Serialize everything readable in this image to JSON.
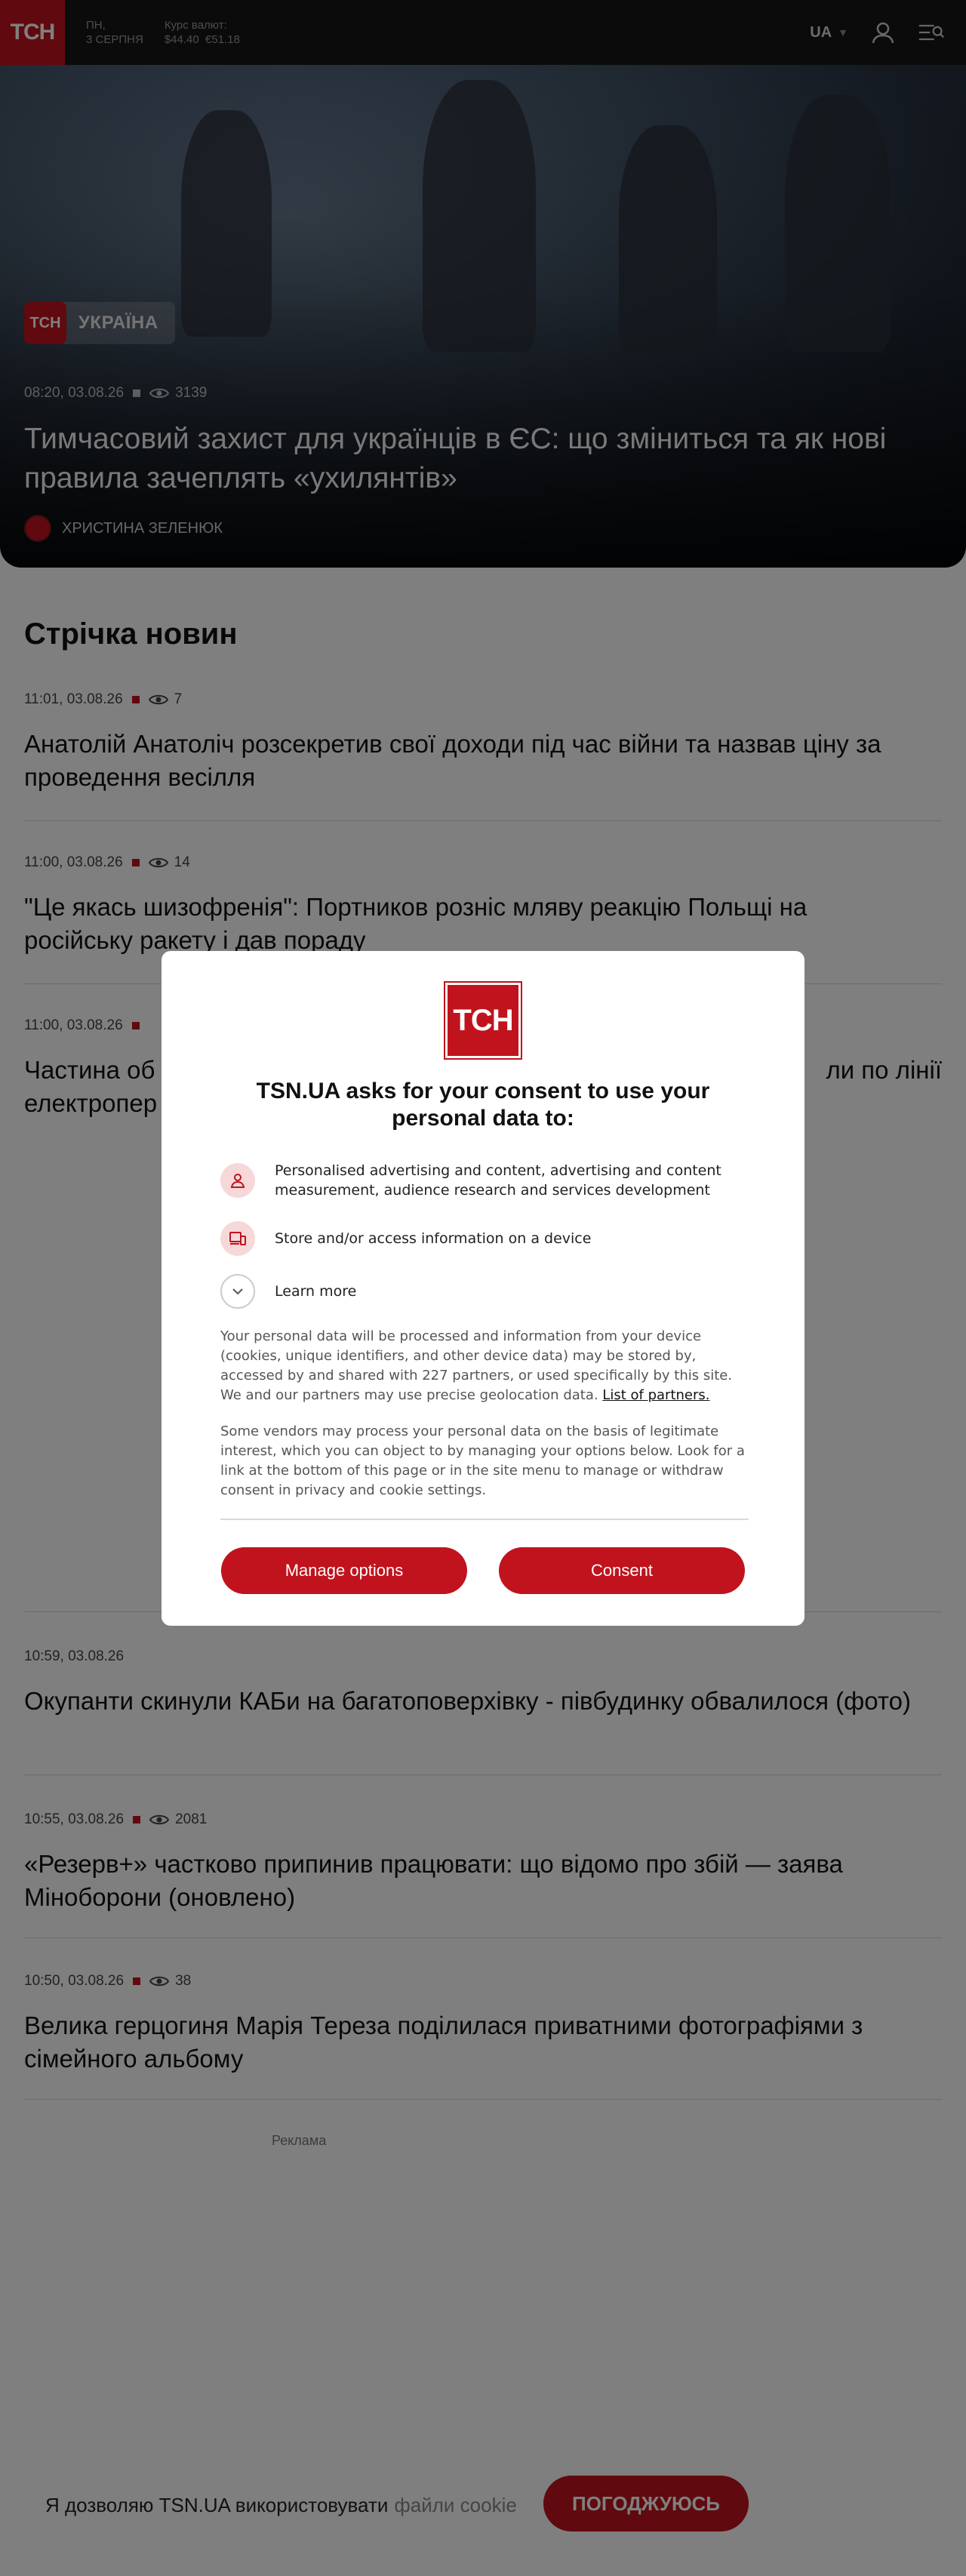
{
  "header": {
    "logo": "ТСН",
    "date_line1": "ПН,",
    "date_line2": "3 СЕРПНЯ",
    "rates_label": "Курс валют:",
    "rate_usd": "$44.40",
    "rate_eur": "€51.18",
    "language": "UA"
  },
  "hero": {
    "category": "УКРАЇНА",
    "tag_logo": "ТСН",
    "time": "08:20, 03.08.26",
    "views": "3139",
    "title": "Тимчасовий захист для українців в ЄС: що зміниться та як нові правила зачеплять «ухилянтів»",
    "author": "ХРИСТИНА ЗЕЛЕНЮК"
  },
  "feed": {
    "title": "Стрічка новин",
    "items": [
      {
        "time": "11:01, 03.08.26",
        "views": "7",
        "title": "Анатолій Анатоліч розсекретив свої доходи під час війни та назвав ціну за проведення весілля"
      },
      {
        "time": "11:00, 03.08.26",
        "views": "14",
        "title": "\"Це якась шизофренія\": Портников розніс мляву реакцію Польщі на російську ракету і дав пораду"
      },
      {
        "time": "11:00, 03.08.26",
        "title_start": "Частина об",
        "title_end": "ли по лінії",
        "title_line2": "електропер"
      },
      {
        "time": "10:59, 03.08.26",
        "title": "Окупанти скинули КАБи на багатоповерхівку - півбудинку обвалилося (фото)"
      },
      {
        "time": "10:55, 03.08.26",
        "views": "2081",
        "title": "«Резерв+» частково припинив працювати: що відомо про збій — заява Міноборони (оновлено)"
      },
      {
        "time": "10:50, 03.08.26",
        "views": "38",
        "title": "Велика герцогиня Марія Тереза поділилася приватними фотографіями з сімейного альбому"
      }
    ],
    "ad_label": "Реклама"
  },
  "consent": {
    "logo": "ТСН",
    "heading": "TSN.UA asks for your consent to use your personal data to:",
    "purposes": [
      {
        "icon": "person-icon",
        "text": "Personalised advertising and content, advertising and content measurement, audience research and services development"
      },
      {
        "icon": "devices-icon",
        "text": "Store and/or access information on a device"
      }
    ],
    "learn_more": "Learn more",
    "para1": "Your personal data will be processed and information from your device (cookies, unique identifiers, and other device data) may be stored by, accessed by and shared with 227 partners, or used specifically by this site. We and our partners may use precise geolocation data.",
    "partners_link": "List of partners.",
    "para2": "Some vendors may process your personal data on the basis of legitimate interest, which you can object to by managing your options below. Look for a link at the bottom of this page or in the site menu to manage or withdraw consent in privacy and cookie settings.",
    "manage_label": "Manage options",
    "consent_label": "Consent"
  },
  "cookie": {
    "text": "Я дозволяю TSN.UA використовувати",
    "link": "файли cookie",
    "button": "ПОГОДЖУЮСЬ"
  },
  "colors": {
    "brand_red": "#c0131d",
    "header_bg": "#171717"
  }
}
